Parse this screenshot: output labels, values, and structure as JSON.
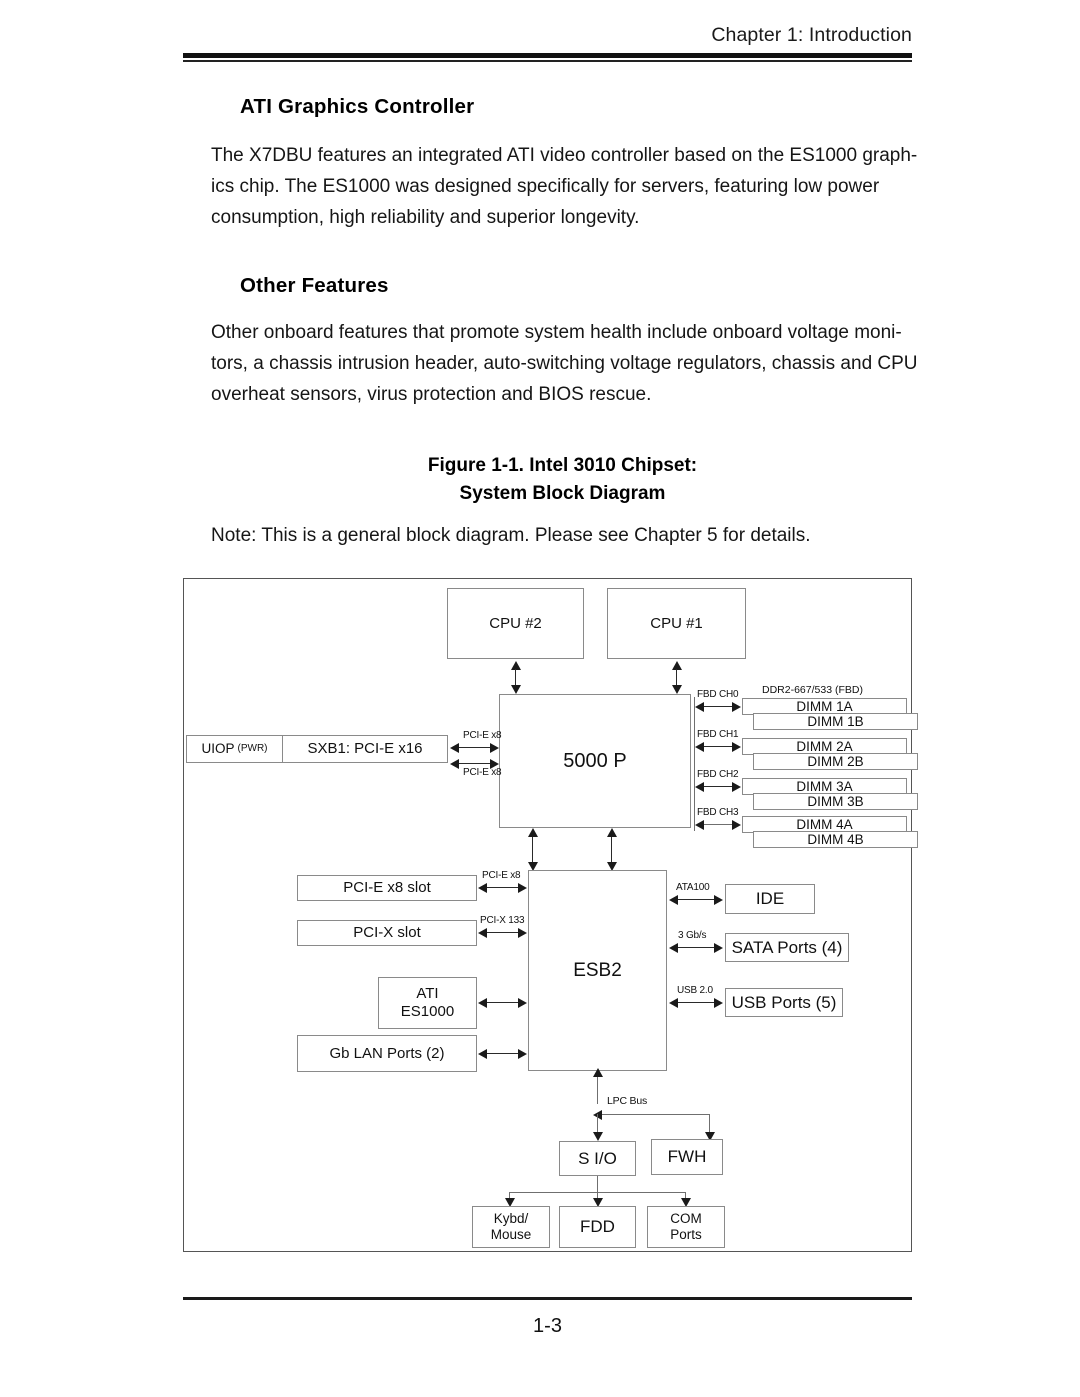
{
  "header": {
    "chapter": "Chapter 1: Introduction"
  },
  "sections": [
    {
      "heading": "ATI Graphics Controller",
      "lines": [
        "The X7DBU features an integrated ATI video controller based on the ES1000 graph-",
        "ics chip.  The ES1000 was designed specifically for servers, featuring low power",
        "consumption, high reliability and superior longevity."
      ]
    },
    {
      "heading": "Other Features",
      "lines": [
        "Other onboard features that promote system health include onboard voltage moni-",
        "tors, a chassis intrusion header, auto-switching voltage regulators, chassis and CPU",
        "overheat sensors, virus protection and BIOS rescue."
      ]
    }
  ],
  "figure": {
    "caption_line1": "Figure 1-1.  Intel 3010 Chipset:",
    "caption_line2": "System Block Diagram",
    "note": "Note: This is a general block diagram.  Please see Chapter 5 for details."
  },
  "diagram": {
    "cpu2": "CPU #2",
    "cpu1": "CPU #1",
    "northbridge": "5000 P",
    "southbridge": "ESB2",
    "uiop": "UIOP",
    "uiop_suffix": "(PWR)",
    "sxb1": "SXB1: PCI-E x16",
    "pcie_x8_upper": "PCI-E x8",
    "pcie_x8_lower": "PCI-E x8",
    "memory_tech": "DDR2-667/533 (FBD)",
    "channels": [
      {
        "label": "FBD CH0",
        "a": "DIMM 1A",
        "b": "DIMM 1B"
      },
      {
        "label": "FBD CH1",
        "a": "DIMM 2A",
        "b": "DIMM 2B"
      },
      {
        "label": "FBD CH2",
        "a": "DIMM 3A",
        "b": "DIMM 3B"
      },
      {
        "label": "FBD CH3",
        "a": "DIMM 4A",
        "b": "DIMM 4B"
      }
    ],
    "left_slots": [
      {
        "name": "PCI-E x8 slot",
        "link": "PCI-E x8"
      },
      {
        "name": "PCI-X slot",
        "link": "PCI-X 133"
      }
    ],
    "ati_line1": "ATI",
    "ati_line2": "ES1000",
    "gb_lan": "Gb LAN Ports (2)",
    "right_periph": [
      {
        "name": "IDE",
        "link": "ATA100"
      },
      {
        "name": "SATA Ports (4)",
        "link": "3 Gb/s"
      },
      {
        "name": "USB Ports (5)",
        "link": "USB 2.0"
      }
    ],
    "lpc_bus": "LPC Bus",
    "sio": "S I/O",
    "fwh": "FWH",
    "sio_children": [
      "Kybd/\nMouse",
      "FDD",
      "COM\nPorts"
    ],
    "kybd_line1": "Kybd/",
    "kybd_line2": "Mouse",
    "fdd": "FDD",
    "com_line1": "COM",
    "com_line2": "Ports"
  },
  "footer": {
    "page_number": "1-3"
  }
}
